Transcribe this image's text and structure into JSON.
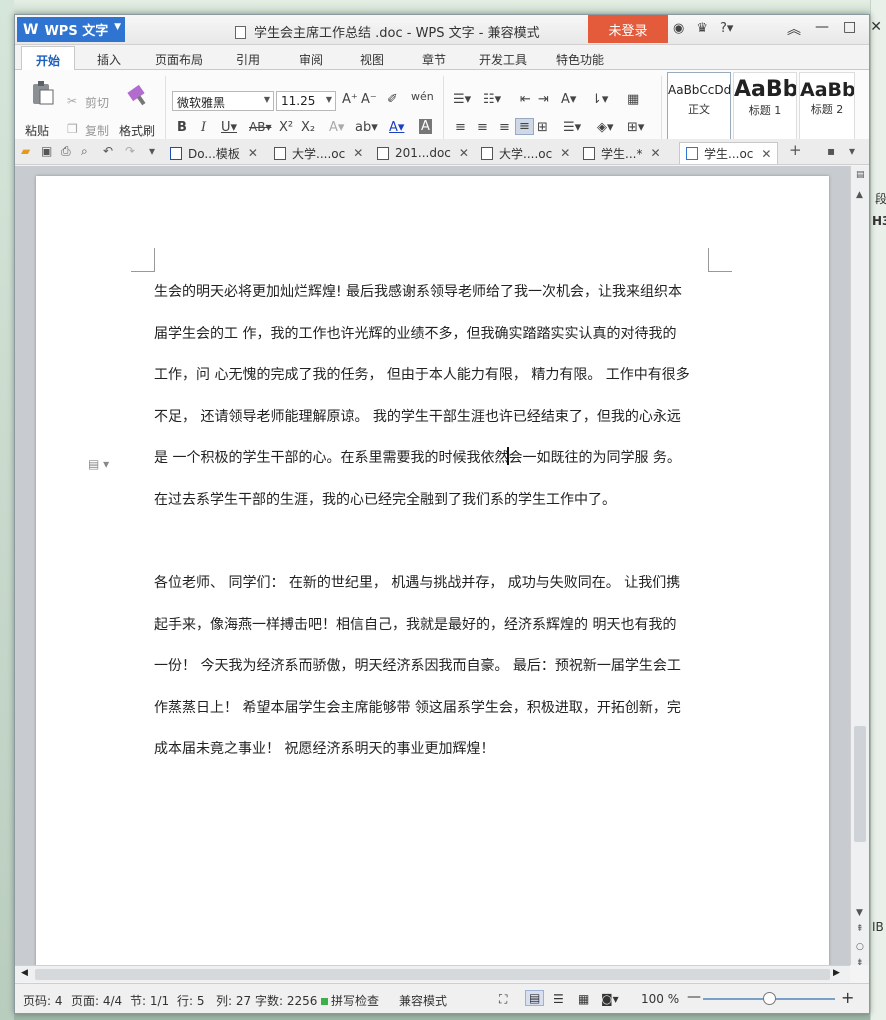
{
  "app": {
    "menu_button": "WPS 文字",
    "window_title": "学生会主席工作总结 .doc - WPS 文字 - 兼容模式",
    "login_label": "未登录"
  },
  "menu_tabs": [
    "开始",
    "插入",
    "页面布局",
    "引用",
    "审阅",
    "视图",
    "章节",
    "开发工具",
    "特色功能"
  ],
  "ribbon": {
    "paste": "粘贴",
    "cut": "剪切",
    "copy": "复制",
    "format_painter": "格式刷",
    "font_name": "微软雅黑",
    "font_size": "11.25",
    "styles": [
      {
        "preview": "AaBbCcDd",
        "name": "正文"
      },
      {
        "preview": "AaBb",
        "name": "标题 1"
      },
      {
        "preview": "AaBb(",
        "name": "标题 2"
      }
    ]
  },
  "doc_tabs": [
    {
      "label": "Do...模板"
    },
    {
      "label": "大学....oc"
    },
    {
      "label": "201...doc"
    },
    {
      "label": "大学....oc"
    },
    {
      "label": "学生...*"
    },
    {
      "label": "学生...oc"
    }
  ],
  "document": {
    "paragraph1": [
      "生会的明天必将更加灿烂辉煌! 最后我感谢系领导老师给了我一次机会，让我来组织本",
      "届学生会的工 作，我的工作也许光辉的业绩不多，但我确实踏踏实实认真的对待我的",
      "工作，问 心无愧的完成了我的任务， 但由于本人能力有限， 精力有限。 工作中有很多",
      "不足， 还请领导老师能理解原谅。 我的学生干部生涯也许已经结束了，但我的心永远",
      "是 一个积极的学生干部的心。在系里需要我的时候我依然",
      "会一如既往的为同学服 务。",
      "在过去系学生干部的生涯，我的心已经完全融到了我们系的学生工作中了。"
    ],
    "paragraph2": [
      "各位老师、 同学们： 在新的世纪里， 机遇与挑战并存， 成功与失败同在。 让我们携",
      "起手来，像海燕一样搏击吧！相信自己，我就是最好的，经济系辉煌的 明天也有我的",
      "一份！ 今天我为经济系而骄傲，明天经济系因我而自豪。 最后：预祝新一届学生会工",
      "作蒸蒸日上！ 希望本届学生会主席能够带 领这届系学生会，积极进取，开拓创新，完",
      "成本届未竟之事业！ 祝愿经济系明天的事业更加辉煌！"
    ]
  },
  "status": {
    "page_code": "页码: 4",
    "pages": "页面: 4/4",
    "section": "节: 1/1",
    "row": "行: 5",
    "col": "列: 27",
    "word_count": "字数: 2256",
    "spell_check": "拼写检查",
    "compat_mode": "兼容模式",
    "zoom": "100 %"
  },
  "desktop": {
    "right_text1": "段",
    "right_text2": "H3",
    "right_text3": "IB"
  }
}
